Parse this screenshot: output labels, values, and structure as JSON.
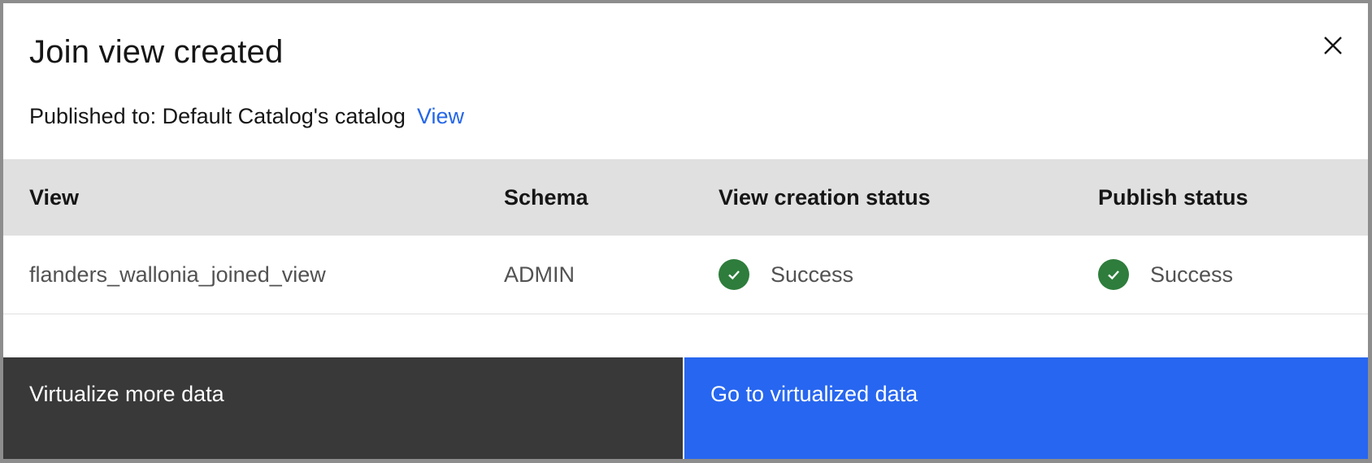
{
  "modal": {
    "title": "Join view created",
    "published_label": "Published to: Default Catalog's catalog",
    "published_link": "View"
  },
  "table": {
    "headers": [
      "View",
      "Schema",
      "View creation status",
      "Publish status"
    ],
    "rows": [
      {
        "view": "flanders_wallonia_joined_view",
        "schema": "ADMIN",
        "view_creation_status": "Success",
        "publish_status": "Success"
      }
    ]
  },
  "footer": {
    "secondary_label": "Virtualize more data",
    "primary_label": "Go to virtualized data"
  },
  "colors": {
    "primary": "#2766f0",
    "secondary": "#393939",
    "success": "#2e7d3c",
    "link": "#2566e8"
  },
  "icons": {
    "close": "close-icon",
    "success": "checkmark-filled-icon"
  }
}
